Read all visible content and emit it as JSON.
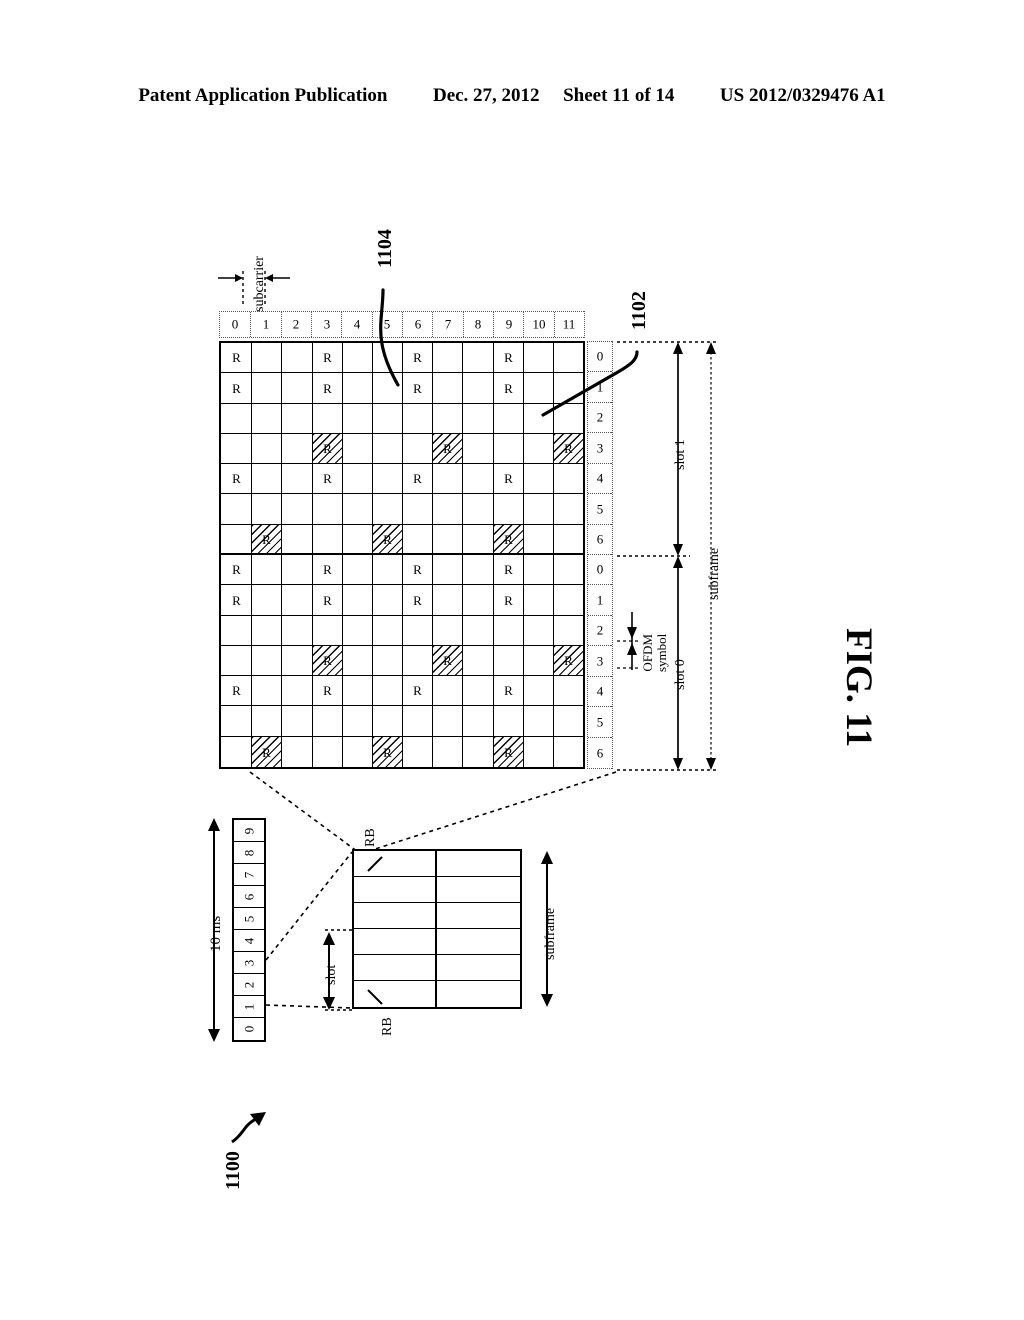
{
  "header": {
    "publication": "Patent Application Publication",
    "date": "Dec. 27, 2012",
    "sheet": "Sheet 11 of 14",
    "patent_number": "US 2012/0329476 A1"
  },
  "figure": {
    "label": "FIG. 11",
    "reference_numeral": "1100",
    "callouts": [
      {
        "id": "1104",
        "target": "hatched-reference-symbol"
      },
      {
        "id": "1102",
        "target": "plain-reference-symbol"
      }
    ]
  },
  "resource_grid": {
    "subcarrier_label": "subcarrier",
    "subcarrier_indices": [
      "0",
      "1",
      "2",
      "3",
      "4",
      "5",
      "6",
      "7",
      "8",
      "9",
      "10",
      "11"
    ],
    "symbol_indices": [
      "0",
      "1",
      "2",
      "3",
      "4",
      "5",
      "6",
      "0",
      "1",
      "2",
      "3",
      "4",
      "5",
      "6"
    ],
    "symbol_cell_text": "R",
    "slot0_label": "slot 0",
    "slot1_label": "slot 1",
    "subframe_label": "subframe",
    "ofdm_symbol_label_line1": "OFDM",
    "ofdm_symbol_label_line2": "symbol",
    "num_symbols": 14,
    "num_subcarriers": 12,
    "plain_r_symbols": [
      0,
      1,
      4,
      7,
      8,
      11
    ],
    "plain_r_subcarriers": [
      0,
      3,
      6,
      9
    ],
    "hatched_r_map": [
      {
        "symbol": 3,
        "subcarriers": [
          3,
          7,
          11
        ]
      },
      {
        "symbol": 6,
        "subcarriers": [
          1,
          5,
          9
        ]
      },
      {
        "symbol": 10,
        "subcarriers": [
          3,
          7,
          11
        ]
      },
      {
        "symbol": 13,
        "subcarriers": [
          1,
          5,
          9
        ]
      }
    ]
  },
  "radio_frame": {
    "duration_label": "10 ms",
    "subframe_indices": [
      "0",
      "1",
      "2",
      "3",
      "4",
      "5",
      "6",
      "7",
      "8",
      "9"
    ]
  },
  "subframe_detail": {
    "rb_label_top": "RB",
    "rb_label_bottom": "RB",
    "slot_label": "slot",
    "subframe_label": "subframe",
    "columns": 6,
    "rows": 2
  },
  "colors": {
    "ink": "#000000",
    "paper": "#ffffff"
  }
}
